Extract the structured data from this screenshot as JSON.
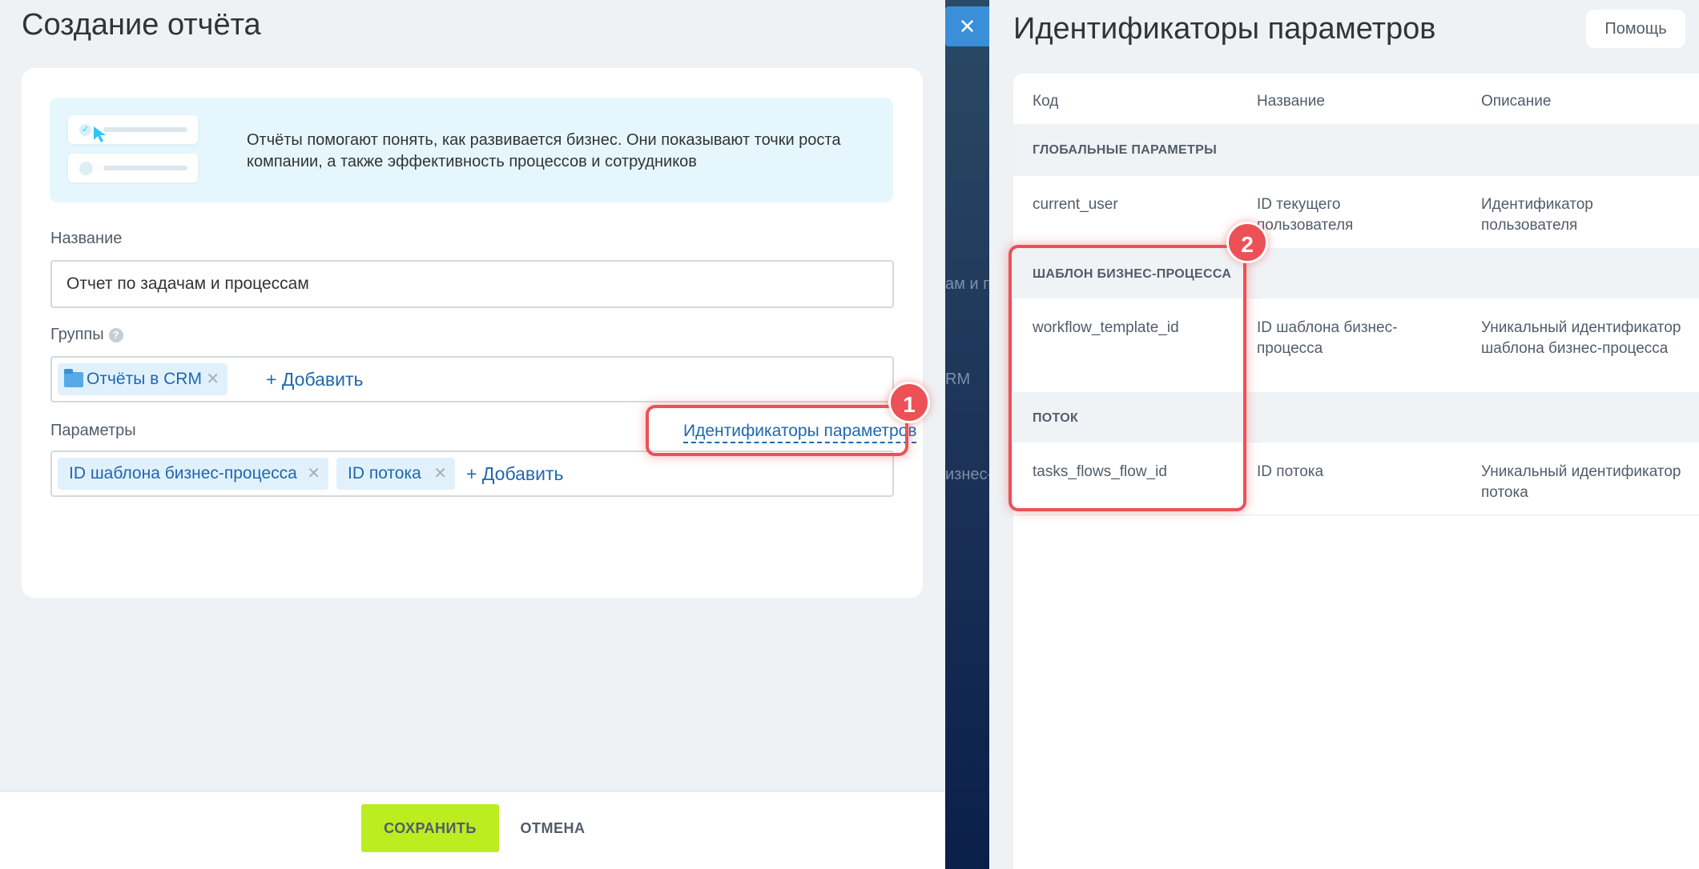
{
  "left": {
    "title": "Создание отчёта",
    "info_text": "Отчёты помогают понять, как развивается бизнес. Они показывают точки роста компании, а также эффективность процессов и сотрудников",
    "name_label": "Название",
    "name_value": "Отчет по задачам и процессам",
    "groups_label": "Группы",
    "groups": [
      {
        "label": "Отчёты в CRM"
      }
    ],
    "groups_add": "+ Добавить",
    "params_label": "Параметры",
    "params_link": "Идентификаторы параметров",
    "params": [
      {
        "label": "ID шаблона бизнес-процесса"
      },
      {
        "label": "ID потока"
      }
    ],
    "params_add": "+ Добавить",
    "save": "СОХРАНИТЬ",
    "cancel": "ОТМЕНА"
  },
  "backdrop": {
    "ghost_texts": [
      "ам и п",
      "RM",
      "изнес-"
    ]
  },
  "right": {
    "title": "Идентификаторы параметров",
    "help": "Помощь",
    "headers": [
      "Код",
      "Название",
      "Описание"
    ],
    "sections": [
      {
        "title": "ГЛОБАЛЬНЫЕ ПАРАМЕТРЫ",
        "rows": [
          {
            "code": "current_user",
            "name": "ID текущего пользователя",
            "desc": "Идентификатор пользователя"
          }
        ]
      },
      {
        "title": "ШАБЛОН БИЗНЕС-ПРОЦЕССА",
        "rows": [
          {
            "code": "workflow_template_id",
            "name": "ID шаблона бизнес-процесса",
            "desc": "Уникальный идентификатор шаблона бизнес-процесса"
          }
        ]
      },
      {
        "title": "ПОТОК",
        "rows": [
          {
            "code": "tasks_flows_flow_id",
            "name": "ID потока",
            "desc": "Уникальный идентификатор потока"
          }
        ]
      }
    ]
  },
  "annotations": {
    "badge1": "1",
    "badge2": "2"
  },
  "colors": {
    "accent": "#2067b0",
    "save_button": "#bbed21",
    "highlight": "#ec5156",
    "info_bg": "#e5f7fd",
    "close_button": "#3a8fd8"
  },
  "icons": {
    "help": "help-circle-icon",
    "folder": "folder-icon",
    "close": "close-icon",
    "remove": "remove-x-icon",
    "check": "check-icon",
    "cursor": "cursor-icon"
  }
}
